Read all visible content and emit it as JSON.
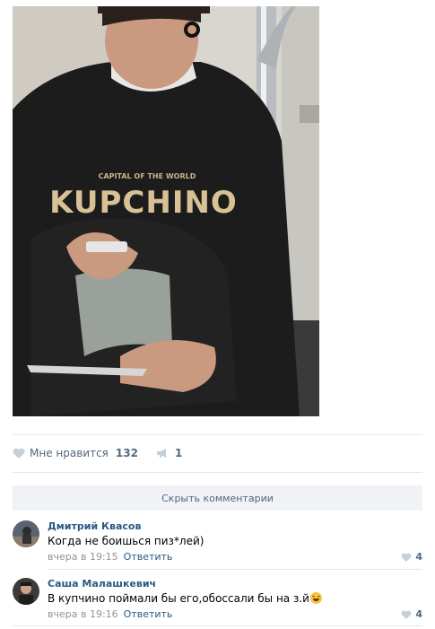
{
  "post": {
    "photo": {
      "shirt_top_line": "CAPITAL OF THE WORLD",
      "shirt_main_text": "KUPCHINO"
    },
    "actions": {
      "like_label": "Мне нравится",
      "like_count": "132",
      "share_count": "1"
    }
  },
  "comments": {
    "hide_label": "Скрыть комментарии",
    "items": [
      {
        "author": "Дмитрий Квасов",
        "text": "Когда не боишься пиз*лей)",
        "time": "вчера в 19:15",
        "reply_label": "Ответить",
        "likes": "4"
      },
      {
        "author": "Саша Малашкевич",
        "text": "В купчино поймали бы его,обоссали бы на з.й",
        "time": "вчера в 19:16",
        "reply_label": "Ответить",
        "likes": "4"
      }
    ]
  },
  "colors": {
    "link": "#2a5885",
    "secondary": "#55677d",
    "meta": "#939393",
    "divider": "#e7e8ec",
    "button_bg": "#f0f2f5"
  },
  "icons": [
    "heart-icon",
    "megaphone-icon",
    "laughing-emoji-icon"
  ]
}
